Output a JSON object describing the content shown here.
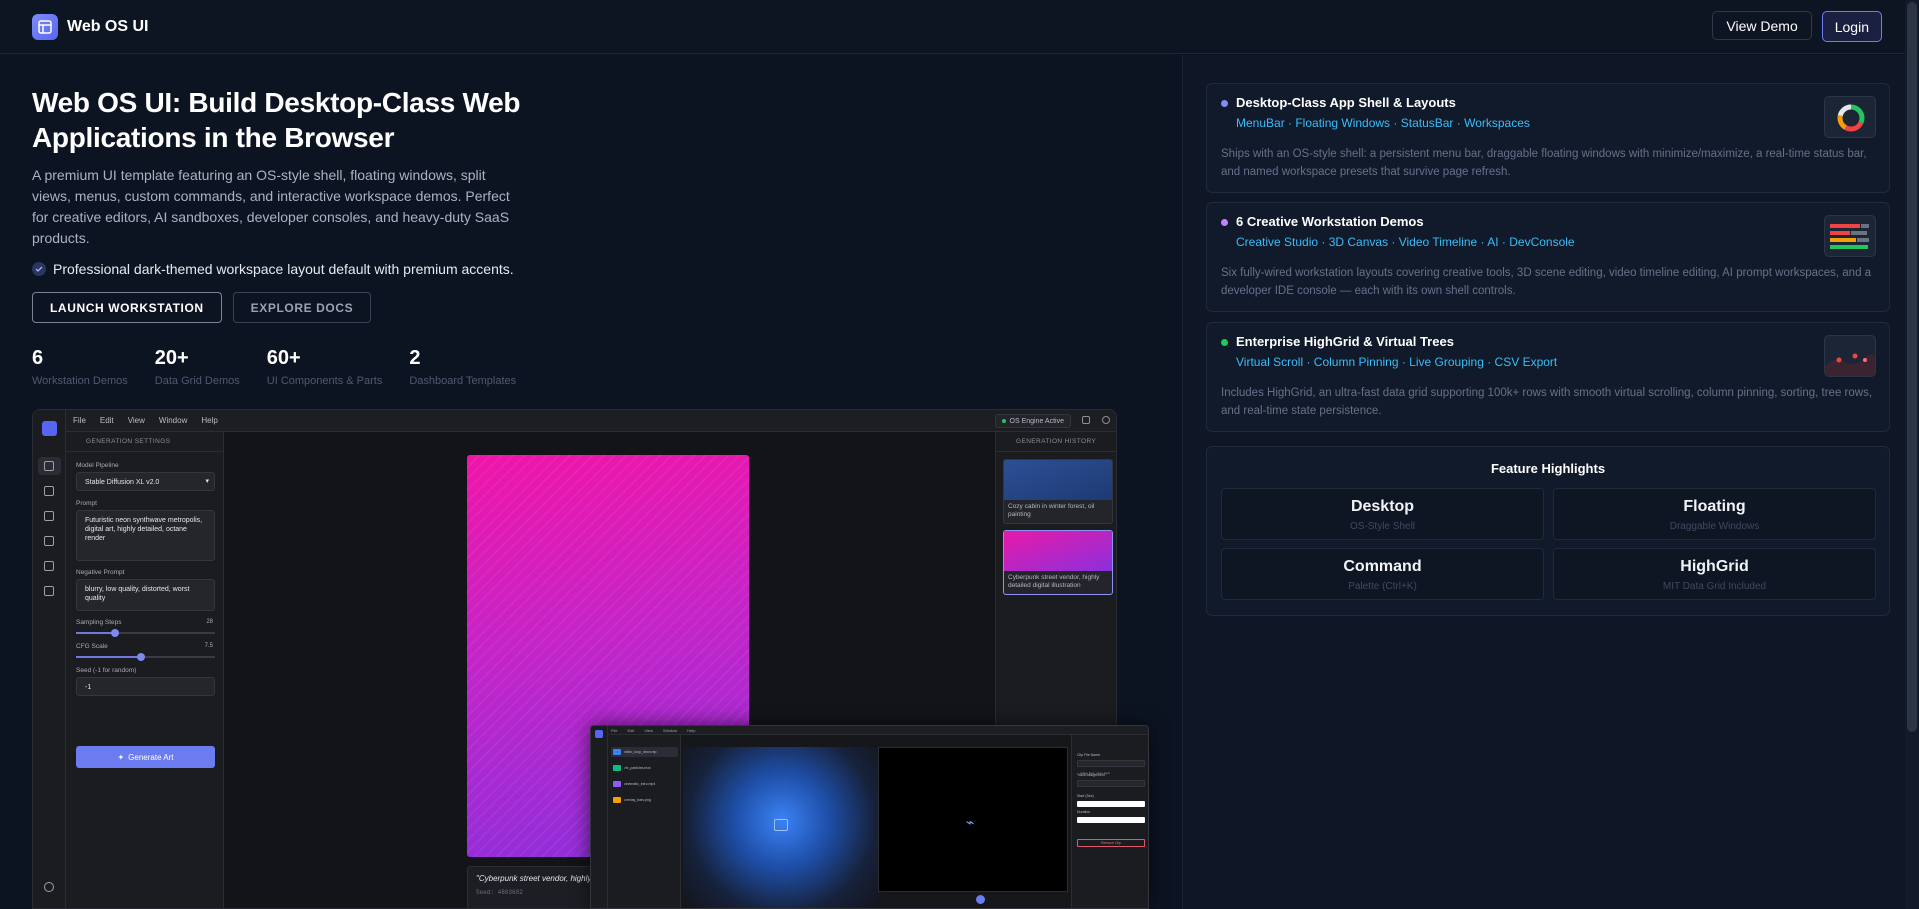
{
  "header": {
    "brand": "Web OS UI",
    "view_demo": "View Demo",
    "login": "Login"
  },
  "hero": {
    "title": "Web OS UI: Build Desktop-Class Web Applications in the Browser",
    "description": "A premium UI template featuring an OS-style shell, floating windows, split views, menus, custom commands, and interactive workspace demos. Perfect for creative editors, AI sandboxes, developer consoles, and heavy-duty SaaS products.",
    "check": "Professional dark-themed workspace layout default with premium accents.",
    "launch": "LAUNCH WORKSTATION",
    "docs": "EXPLORE DOCS"
  },
  "stats": [
    {
      "num": "6",
      "label": "Workstation Demos"
    },
    {
      "num": "20+",
      "label": "Data Grid Demos"
    },
    {
      "num": "60+",
      "label": "UI Components & Parts"
    },
    {
      "num": "2",
      "label": "Dashboard Templates"
    }
  ],
  "workstation": {
    "menus": [
      "File",
      "Edit",
      "View",
      "Window",
      "Help"
    ],
    "status": "OS Engine Active",
    "settings_title": "GENERATION SETTINGS",
    "model_label": "Model Pipeline",
    "model_value": "Stable Diffusion XL v2.0",
    "prompt_label": "Prompt",
    "prompt_value": "Futuristic neon synthwave metropolis, digital art, highly detailed, octane render",
    "neg_label": "Negative Prompt",
    "neg_value": "blurry, low quality, distorted, worst quality",
    "steps_label": "Sampling Steps",
    "steps_value": "28",
    "steps_fraction": 0.28,
    "cfg_label": "CFG Scale",
    "cfg_value": "7.5",
    "cfg_fraction": 0.47,
    "seed_label": "Seed (-1 for random)",
    "seed_value": "-1",
    "generate": "Generate Art",
    "caption": "\"Cyberpunk street vendor, highly",
    "caption_seed": "Seed: 4803682",
    "history_title": "GENERATION HISTORY",
    "history": [
      {
        "text": "Cozy cabin in winter forest, oil painting",
        "color": "#2a4a8c"
      },
      {
        "text": "Cyberpunk street vendor, highly detailed digital illustration",
        "color": "#c21fc9"
      }
    ]
  },
  "window2": {
    "menus": [
      "File",
      "Edit",
      "View",
      "Window",
      "Help"
    ],
    "items": [
      {
        "label": "video_loop_neon.mp",
        "color": "#3b82f6"
      },
      {
        "label": "vfx_particles.mov",
        "color": "#10b981"
      },
      {
        "label": "cinematic_intro.mp4",
        "color": "#8b5cf6"
      },
      {
        "label": "overlay_bars.png",
        "color": "#f59e0b"
      }
    ],
    "prop_clip": "Clip File Name",
    "prop_clip_value": "video_loop_neon.mp4",
    "prop_bg": "Track Assignment",
    "prop_start": "Start (Sec)",
    "prop_duration": "Duration",
    "remove": "Remove Clip"
  },
  "features": [
    {
      "title": "Desktop-Class App Shell & Layouts",
      "tags": "MenuBar · Floating Windows · StatusBar · Workspaces",
      "desc": "Ships with an OS-style shell: a persistent menu bar, draggable floating windows with minimize/maximize, a real-time status bar, and named workspace presets that survive page refresh.",
      "dot": "#818cf8"
    },
    {
      "title": "6 Creative Workstation Demos",
      "tags": "Creative Studio · 3D Canvas · Video Timeline · AI · DevConsole",
      "desc": "Six fully-wired workstation layouts covering creative tools, 3D scene editing, video timeline editing, AI prompt workspaces, and a developer IDE console — each with its own shell controls.",
      "dot": "#c084fc"
    },
    {
      "title": "Enterprise HighGrid & Virtual Trees",
      "tags": "Virtual Scroll · Column Pinning · Live Grouping · CSV Export",
      "desc": "Includes HighGrid, an ultra-fast data grid supporting 100k+ rows with smooth virtual scrolling, column pinning, sorting, tree rows, and real-time state persistence.",
      "dot": "#22c55e"
    }
  ],
  "highlights": {
    "title": "Feature Highlights",
    "items": [
      {
        "main": "Desktop",
        "sub": "OS-Style Shell"
      },
      {
        "main": "Floating",
        "sub": "Draggable Windows"
      },
      {
        "main": "Command",
        "sub": "Palette (Ctrl+K)"
      },
      {
        "main": "HighGrid",
        "sub": "MIT Data Grid Included"
      }
    ]
  }
}
